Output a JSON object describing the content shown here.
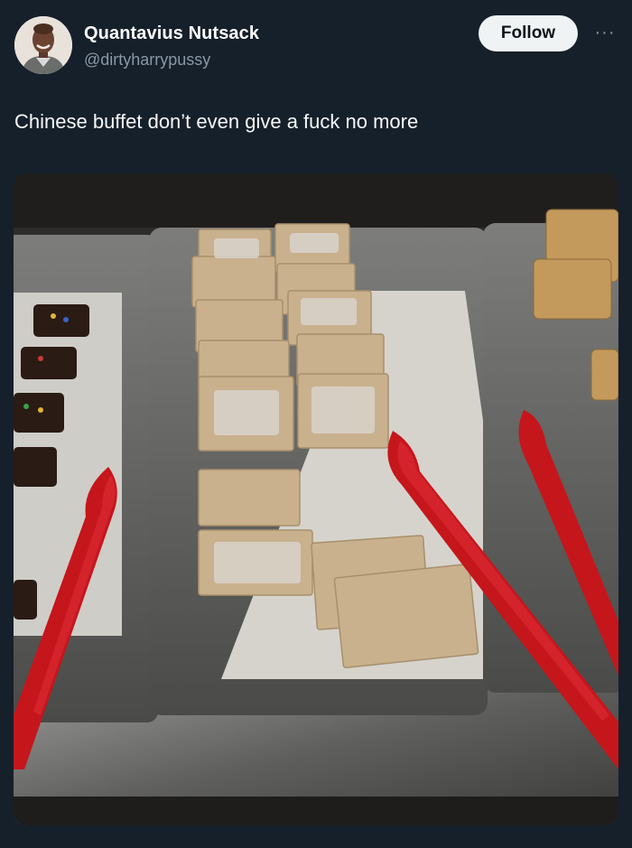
{
  "tweet": {
    "author_name": "Quantavius Nutsack",
    "author_handle": "@dirtyharrypussy",
    "follow_label": "Follow",
    "more_label": "···",
    "text": "Chinese buffet don’t even give a fuck no more"
  },
  "media": {
    "description_icon": "photo"
  },
  "colors": {
    "background": "#15202b",
    "follow_button_bg": "#eff3f4",
    "handle_gray": "#8b98a5"
  }
}
